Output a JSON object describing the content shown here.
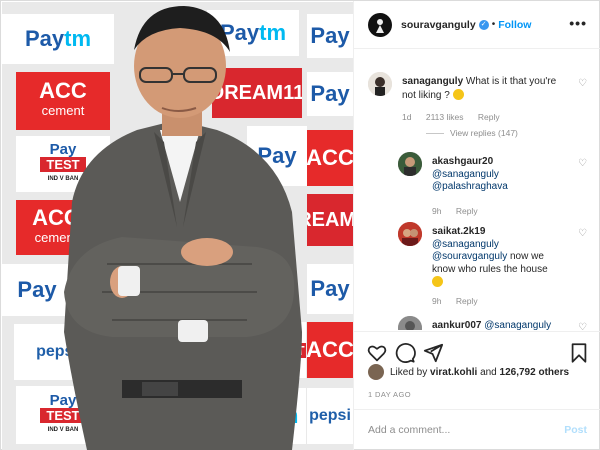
{
  "post": {
    "username": "souravganguly",
    "follow_label": "Follow",
    "separator": "•",
    "more_label": "•••"
  },
  "media": {
    "boards": {
      "paytm_pay": "Pay",
      "paytm_tm": "tm",
      "acc_top": "ACC",
      "acc_bottom": "cement",
      "dream": "DREAM11",
      "pepsi": "pepsi",
      "test": "TEST",
      "ind_v_ban": "IND V BAN"
    },
    "colors": {
      "paytm_blue": "#1d5aa8",
      "paytm_cyan": "#00b9f1",
      "acc_red": "#e62a2a",
      "suit": "#5b5a57"
    }
  },
  "comments": [
    {
      "username": "sanaganguly",
      "text": "What is it that you're not liking ?",
      "emoji": "face-with-rolling-eyes",
      "time": "1d",
      "likes": "2113 likes",
      "reply_label": "Reply",
      "view_replies": "View replies (147)"
    },
    {
      "username": "akashgaur20",
      "mentions": [
        "@sanaganguly",
        "@palashraghava"
      ],
      "time": "9h",
      "reply_label": "Reply"
    },
    {
      "username": "saikat.2k19",
      "mentions": [
        "@sanaganguly",
        "@souravganguly"
      ],
      "text": "now we know who rules the house",
      "emoji": "grinning-face",
      "time": "9h",
      "reply_label": "Reply"
    },
    {
      "username": "aankur007",
      "mentions": [
        "@sanaganguly"
      ]
    }
  ],
  "likes": {
    "prefix": "Liked by",
    "user": "virat.kohli",
    "connector": "and",
    "others": "126,792 others"
  },
  "timestamp": "1 DAY AGO",
  "add_comment": {
    "placeholder": "Add a comment...",
    "post_label": "Post"
  },
  "colors": {
    "link_blue": "#0095f6",
    "mention_blue": "#00376b",
    "meta_gray": "#8e8e8e",
    "verified_blue": "#3897f0"
  },
  "icons": [
    "heart-icon",
    "comment-icon",
    "share-icon",
    "bookmark-icon",
    "verified-icon"
  ]
}
